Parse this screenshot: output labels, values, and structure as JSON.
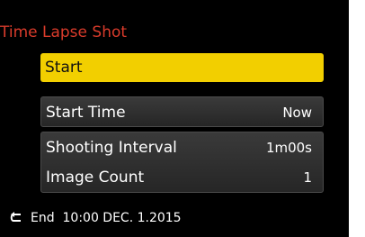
{
  "title": "Time Lapse Shot",
  "start_button": "Start",
  "start_time": {
    "label": "Start Time",
    "value": "Now"
  },
  "shooting_interval": {
    "label": "Shooting Interval",
    "value": "1m00s"
  },
  "image_count": {
    "label": "Image Count",
    "value": "1"
  },
  "footer": {
    "icon": "back-arrow-icon",
    "text": "End  10:00 DEC. 1.2015"
  },
  "colors": {
    "title": "#d93b2b",
    "highlight": "#f2cf00",
    "background": "#000000"
  }
}
